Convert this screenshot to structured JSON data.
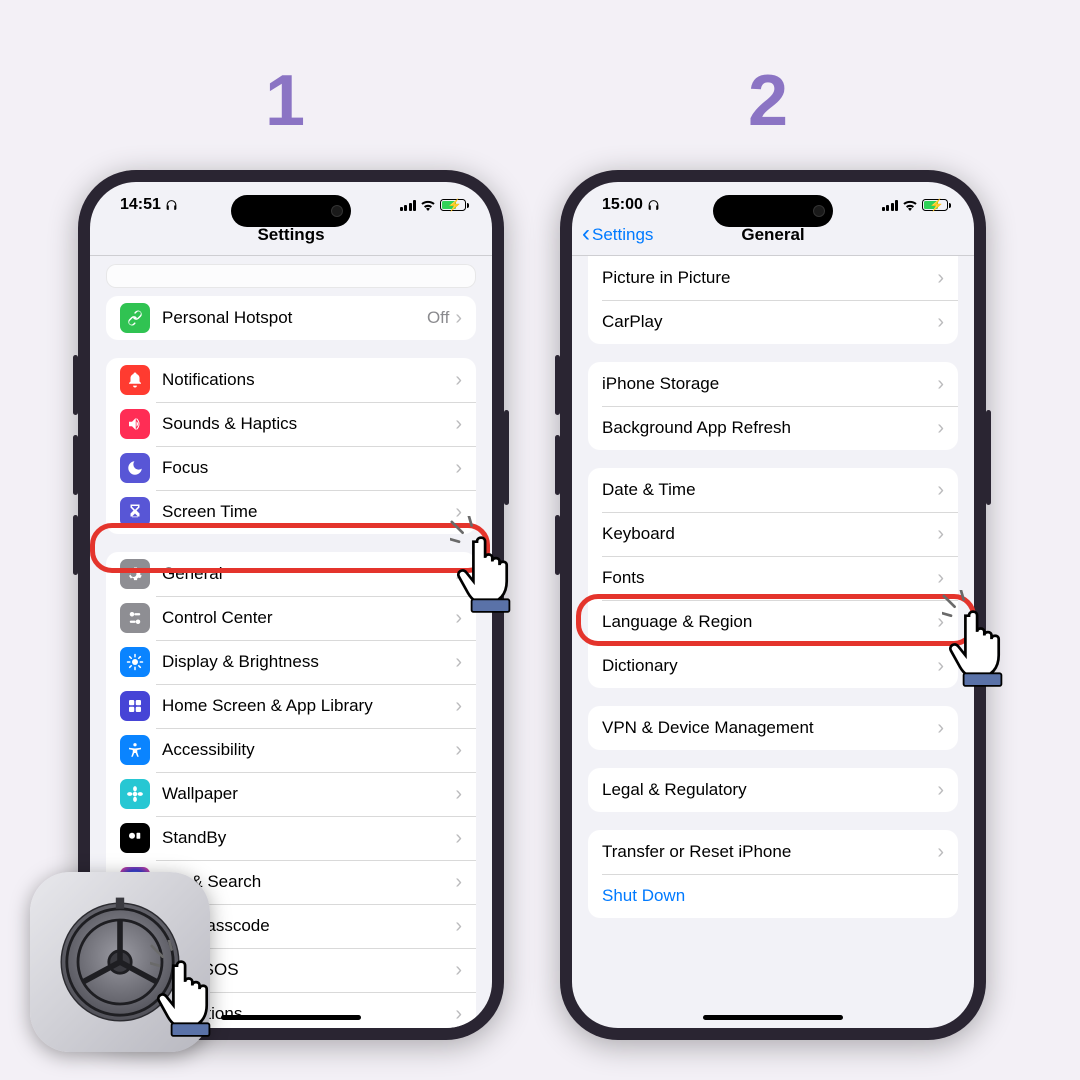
{
  "steps": {
    "one": "1",
    "two": "2"
  },
  "phone1": {
    "time": "14:51",
    "title": "Settings",
    "group_hotspot": [
      {
        "label": "Personal Hotspot",
        "value": "Off",
        "icon": "link-icon",
        "color": "#30c352"
      }
    ],
    "group_notif": [
      {
        "label": "Notifications",
        "icon": "bell-icon",
        "color": "#ff3b30"
      },
      {
        "label": "Sounds & Haptics",
        "icon": "speaker-icon",
        "color": "#ff2d55"
      },
      {
        "label": "Focus",
        "icon": "moon-icon",
        "color": "#5856d6"
      },
      {
        "label": "Screen Time",
        "icon": "hourglass-icon",
        "color": "#5856d6"
      }
    ],
    "group_general": [
      {
        "label": "General",
        "icon": "gear-icon",
        "color": "#8e8e93"
      },
      {
        "label": "Control Center",
        "icon": "switches-icon",
        "color": "#8e8e93"
      },
      {
        "label": "Display & Brightness",
        "icon": "sun-icon",
        "color": "#0a84ff"
      },
      {
        "label": "Home Screen & App Library",
        "icon": "grid-icon",
        "color": "#4644d6"
      },
      {
        "label": "Accessibility",
        "icon": "accessibility-icon",
        "color": "#0a84ff"
      },
      {
        "label": "Wallpaper",
        "icon": "flower-icon",
        "color": "#27c7d3"
      },
      {
        "label": "StandBy",
        "icon": "standby-icon",
        "color": "#000000"
      },
      {
        "label": "Siri & Search",
        "icon": "siri-icon",
        "color": "#1c1c1e"
      },
      {
        "label": "Face ID & Passcode",
        "icon": "faceid-icon",
        "color": "#30d158",
        "truncate_prefix": "D & Passcode"
      },
      {
        "label": "Emergency SOS",
        "icon": "sos-icon",
        "color": "#ff3b30",
        "truncate_prefix": "ency SOS"
      },
      {
        "label": "Exposure Notifications",
        "icon": "exposure-icon",
        "color": "#ffffff",
        "truncate_prefix": "otifications"
      }
    ]
  },
  "phone2": {
    "time": "15:00",
    "title": "General",
    "back": "Settings",
    "group_top": [
      {
        "label": "Picture in Picture"
      },
      {
        "label": "CarPlay"
      }
    ],
    "group_storage": [
      {
        "label": "iPhone Storage"
      },
      {
        "label": "Background App Refresh"
      }
    ],
    "group_lang": [
      {
        "label": "Date & Time"
      },
      {
        "label": "Keyboard"
      },
      {
        "label": "Fonts"
      },
      {
        "label": "Language & Region"
      },
      {
        "label": "Dictionary"
      }
    ],
    "group_vpn": [
      {
        "label": "VPN & Device Management"
      }
    ],
    "group_legal": [
      {
        "label": "Legal & Regulatory"
      }
    ],
    "group_reset": [
      {
        "label": "Transfer or Reset iPhone"
      },
      {
        "label": "Shut Down",
        "link": true
      }
    ]
  }
}
